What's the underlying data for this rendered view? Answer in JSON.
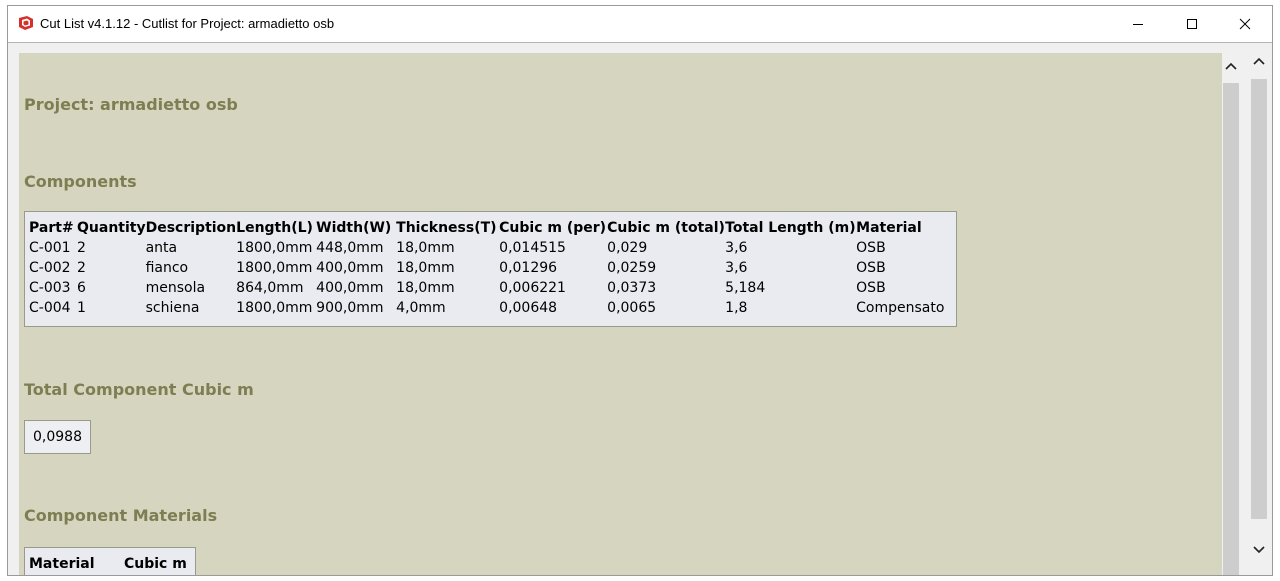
{
  "window": {
    "title": "Cut List v4.1.12 -  Cutlist for Project: armadietto osb"
  },
  "report": {
    "project_heading": "Project: armadietto osb",
    "components_heading": "Components",
    "columns": [
      "Part#",
      "Quantity",
      "Description",
      "Length(L)",
      "Width(W)",
      "Thickness(T)",
      "Cubic m (per)",
      "Cubic m (total)",
      "Total Length (m)",
      "Material"
    ],
    "rows": [
      [
        "C-001",
        "2",
        "anta",
        "1800,0mm",
        "448,0mm",
        "18,0mm",
        "0,014515",
        "0,029",
        "3,6",
        "OSB"
      ],
      [
        "C-002",
        "2",
        "fianco",
        "1800,0mm",
        "400,0mm",
        "18,0mm",
        "0,01296",
        "0,0259",
        "3,6",
        "OSB"
      ],
      [
        "C-003",
        "6",
        "mensola",
        "864,0mm",
        "400,0mm",
        "18,0mm",
        "0,006221",
        "0,0373",
        "5,184",
        "OSB"
      ],
      [
        "C-004",
        "1",
        "schiena",
        "1800,0mm",
        "900,0mm",
        "4,0mm",
        "0,00648",
        "0,0065",
        "1,8",
        "Compensato"
      ]
    ],
    "total_heading": "Total Component Cubic m",
    "total_value": "0,0988",
    "materials_heading": "Component Materials",
    "materials_columns": [
      "Material",
      "Cubic m"
    ]
  },
  "icons": {
    "app": "sketchup-icon",
    "minimize": "minimize-icon",
    "maximize": "maximize-icon",
    "close": "close-icon",
    "scroll_up": "chevron-up-icon",
    "scroll_down": "chevron-down-icon"
  },
  "colors": {
    "report_background": "#d6d5bf",
    "heading": "#7e7e53",
    "table_background": "#e9ebf0",
    "app_icon_red": "#d4302c"
  }
}
